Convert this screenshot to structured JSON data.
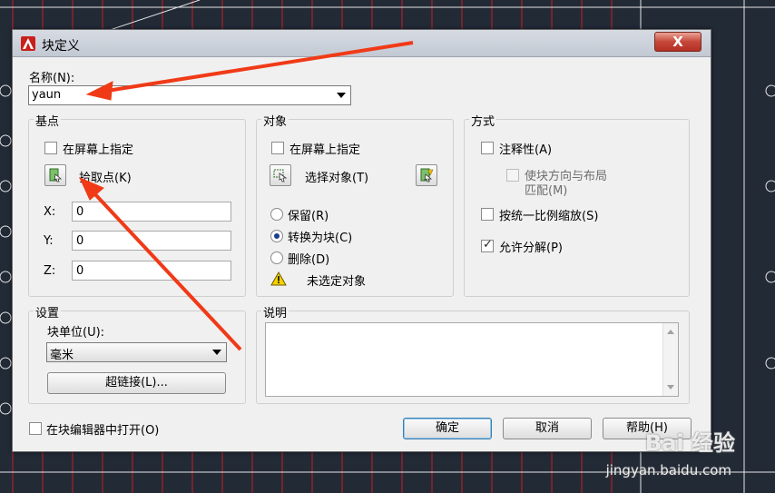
{
  "window": {
    "title": "块定义",
    "close_label": "X"
  },
  "name": {
    "label": "名称(N):",
    "value": "yaun"
  },
  "base_point": {
    "title": "基点",
    "specify_on_screen": "在屏幕上指定",
    "pick_point": "拾取点(K)",
    "x_label": "X:",
    "x_value": "0",
    "y_label": "Y:",
    "y_value": "0",
    "z_label": "Z:",
    "z_value": "0"
  },
  "objects": {
    "title": "对象",
    "specify_on_screen": "在屏幕上指定",
    "select_objects": "选择对象(T)",
    "retain": "保留(R)",
    "convert_to_block": "转换为块(C)",
    "delete": "删除(D)",
    "status": "未选定对象"
  },
  "behavior": {
    "title": "方式",
    "annotative": "注释性(A)",
    "match_orientation_line1": "使块方向与布局",
    "match_orientation_line2": "匹配(M)",
    "scale_uniformly": "按统一比例缩放(S)",
    "allow_exploding": "允许分解(P)",
    "allow_exploding_checked": true
  },
  "settings": {
    "title": "设置",
    "block_unit_label": "块单位(U):",
    "block_unit_value": "毫米",
    "hyperlink_button": "超链接(L)..."
  },
  "description": {
    "title": "说明"
  },
  "footer": {
    "open_in_editor": "在块编辑器中打开(O)",
    "ok": "确定",
    "cancel": "取消",
    "help": "帮助(H)"
  },
  "watermark": {
    "brand": "Bai 经验",
    "url": "jingyan.baidu.com"
  },
  "colors": {
    "annotation_arrow": "#f03a17",
    "cad_background": "#222a36",
    "cad_grid": "#d21f1f"
  }
}
